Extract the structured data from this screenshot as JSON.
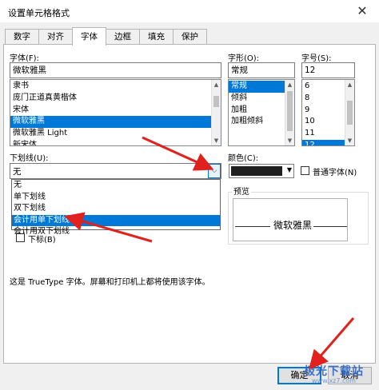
{
  "window": {
    "title": "设置单元格格式",
    "close_glyph": "✕"
  },
  "tabs": [
    {
      "label": "数字"
    },
    {
      "label": "对齐"
    },
    {
      "label": "字体"
    },
    {
      "label": "边框"
    },
    {
      "label": "填充"
    },
    {
      "label": "保护"
    }
  ],
  "active_tab": "字体",
  "font": {
    "label": "字体(F):",
    "value": "微软雅黑",
    "list": [
      "隶书",
      "庞门正道真黄楷体",
      "宋体",
      "微软雅黑",
      "微软雅黑 Light",
      "新宋体"
    ],
    "selected": "微软雅黑"
  },
  "style": {
    "label": "字形(O):",
    "value": "常规",
    "list": [
      "常规",
      "倾斜",
      "加粗",
      "加粗倾斜"
    ],
    "selected": "常规"
  },
  "size": {
    "label": "字号(S):",
    "value": "12",
    "list": [
      "6",
      "8",
      "9",
      "10",
      "11",
      "12"
    ],
    "selected": "12"
  },
  "underline": {
    "label": "下划线(U):",
    "value": "无",
    "options": [
      "无",
      "单下划线",
      "双下划线",
      "会计用单下划线",
      "会计用双下划线"
    ],
    "highlighted": "会计用单下划线"
  },
  "color": {
    "label": "颜色(C):",
    "value": "#1f1f1f"
  },
  "normal_font": {
    "label": "普通字体(N)",
    "checked": false
  },
  "subscript": {
    "label": "下标(B)"
  },
  "preview": {
    "label": "预览",
    "text": "微软雅黑"
  },
  "info_text": "这是 TrueType 字体。屏幕和打印机上都将使用该字体。",
  "buttons": {
    "ok": "确定",
    "cancel": "取消"
  },
  "watermark": {
    "text": "极光下载站",
    "sub": "www.xz7.com"
  },
  "annotation_color": "#e0211d"
}
